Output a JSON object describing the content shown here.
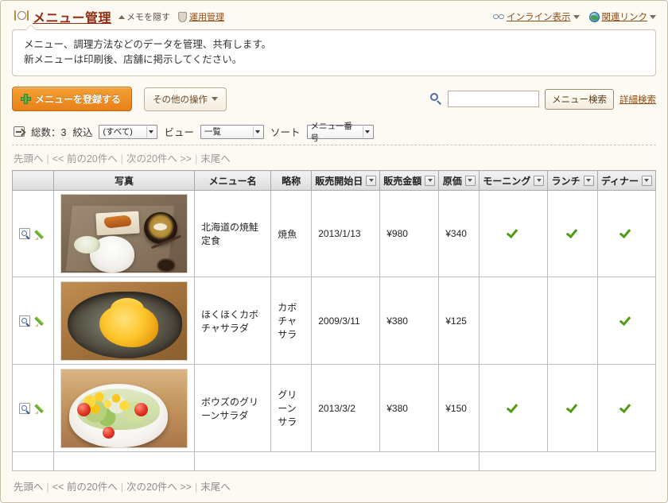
{
  "header": {
    "dish_icon": "dish-icon",
    "title": "メニュー管理",
    "memo_toggle": "メモを隠す",
    "shield_icon": "shield-icon",
    "admin_link": "運用管理",
    "chain_icon": "chain-link-icon",
    "inline_display": "インライン表示",
    "globe_icon": "globe-icon",
    "related_links": "関連リンク"
  },
  "memo": {
    "line1": "メニュー、調理方法などのデータを管理、共有します。",
    "line2": "新メニューは印刷後、店舗に掲示してください。"
  },
  "toolbar": {
    "plus_icon": "plus-icon",
    "register_label": "メニューを登録する",
    "other_actions_label": "その他の操作",
    "search_icon": "search-icon",
    "search_value": "",
    "search_placeholder": "",
    "search_button": "メニュー検索",
    "advanced_search": "詳細検索"
  },
  "filterbar": {
    "list_icon": "list-icon",
    "total_label": "総数：3",
    "filter_label": "絞込",
    "filter_value": "(すべて)",
    "view_label": "ビュー",
    "view_value": "一覧",
    "sort_label": "ソート",
    "sort_value": "メニュー番号"
  },
  "pager": {
    "first": "先頭へ",
    "prev": "<< 前の20件へ",
    "next": "次の20件へ >>",
    "last": "末尾へ"
  },
  "table": {
    "columns": [
      {
        "label": "",
        "has_arrow": false
      },
      {
        "label": "写真",
        "has_arrow": false
      },
      {
        "label": "メニュー名",
        "has_arrow": false
      },
      {
        "label": "略称",
        "has_arrow": false
      },
      {
        "label": "販売開始日",
        "has_arrow": true
      },
      {
        "label": "販売金額",
        "has_arrow": true
      },
      {
        "label": "原価",
        "has_arrow": true
      },
      {
        "label": "モーニング",
        "has_arrow": true
      },
      {
        "label": "ランチ",
        "has_arrow": true
      },
      {
        "label": "ディナー",
        "has_arrow": true
      }
    ],
    "rows": [
      {
        "preview_icon": "preview-icon",
        "edit_icon": "edit-pencil-icon",
        "photo_alt": "北海道の焼鮭定食の写真",
        "name": "北海道の焼鮭定食",
        "short_name": "焼魚",
        "start_date": "2013/1/13",
        "price": "¥980",
        "cost": "¥340",
        "morning": true,
        "lunch": true,
        "dinner": true
      },
      {
        "preview_icon": "preview-icon",
        "edit_icon": "edit-pencil-icon",
        "photo_alt": "ほくほくカボチャサラダの写真",
        "name": "ほくほくカボチャサラダ",
        "short_name": "カボチャサラ",
        "start_date": "2009/3/11",
        "price": "¥380",
        "cost": "¥125",
        "morning": false,
        "lunch": false,
        "dinner": true
      },
      {
        "preview_icon": "preview-icon",
        "edit_icon": "edit-pencil-icon",
        "photo_alt": "ボウズのグリーンサラダの写真",
        "name": "ボウズのグリーンサラダ",
        "short_name": "グリーンサラ",
        "start_date": "2013/3/2",
        "price": "¥380",
        "cost": "¥150",
        "morning": true,
        "lunch": true,
        "dinner": true
      }
    ]
  },
  "colors": {
    "accent_orange": "#e8801a",
    "title_red": "#8f2b12",
    "link_brown": "#8f4b12",
    "check_green": "#4f9b16",
    "page_bg": "#fdfaf4"
  }
}
